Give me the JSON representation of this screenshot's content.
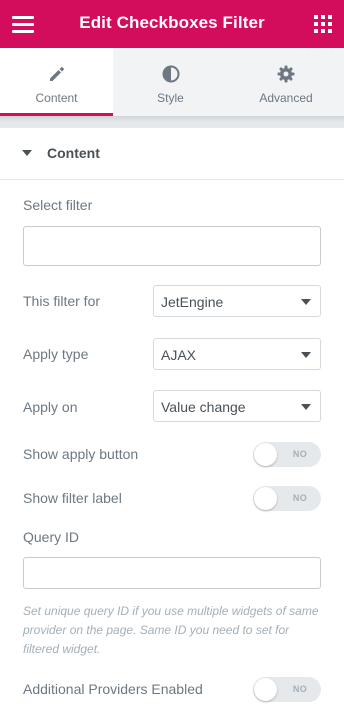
{
  "header": {
    "title": "Edit Checkboxes Filter",
    "menu_icon": "hamburger-menu-icon",
    "apps_icon": "grid-apps-icon",
    "bg_color": "#d30c5c"
  },
  "tabs": [
    {
      "label": "Content",
      "icon": "pencil-icon",
      "active": true
    },
    {
      "label": "Style",
      "icon": "half-circle-icon",
      "active": false
    },
    {
      "label": "Advanced",
      "icon": "gear-icon",
      "active": false
    }
  ],
  "section": {
    "title": "Content",
    "expanded": true
  },
  "controls": {
    "select_filter": {
      "label": "Select filter",
      "value": ""
    },
    "filter_for": {
      "label": "This filter for",
      "value": "JetEngine"
    },
    "apply_type": {
      "label": "Apply type",
      "value": "AJAX"
    },
    "apply_on": {
      "label": "Apply on",
      "value": "Value change"
    },
    "show_apply_button": {
      "label": "Show apply button",
      "state": "NO"
    },
    "show_filter_label": {
      "label": "Show filter label",
      "state": "NO"
    },
    "query_id": {
      "label": "Query ID",
      "value": "",
      "description": "Set unique query ID if you use multiple widgets of same provider on the page. Same ID you need to set for filtered widget."
    },
    "additional_providers": {
      "label": "Additional Providers Enabled",
      "state": "NO"
    }
  }
}
